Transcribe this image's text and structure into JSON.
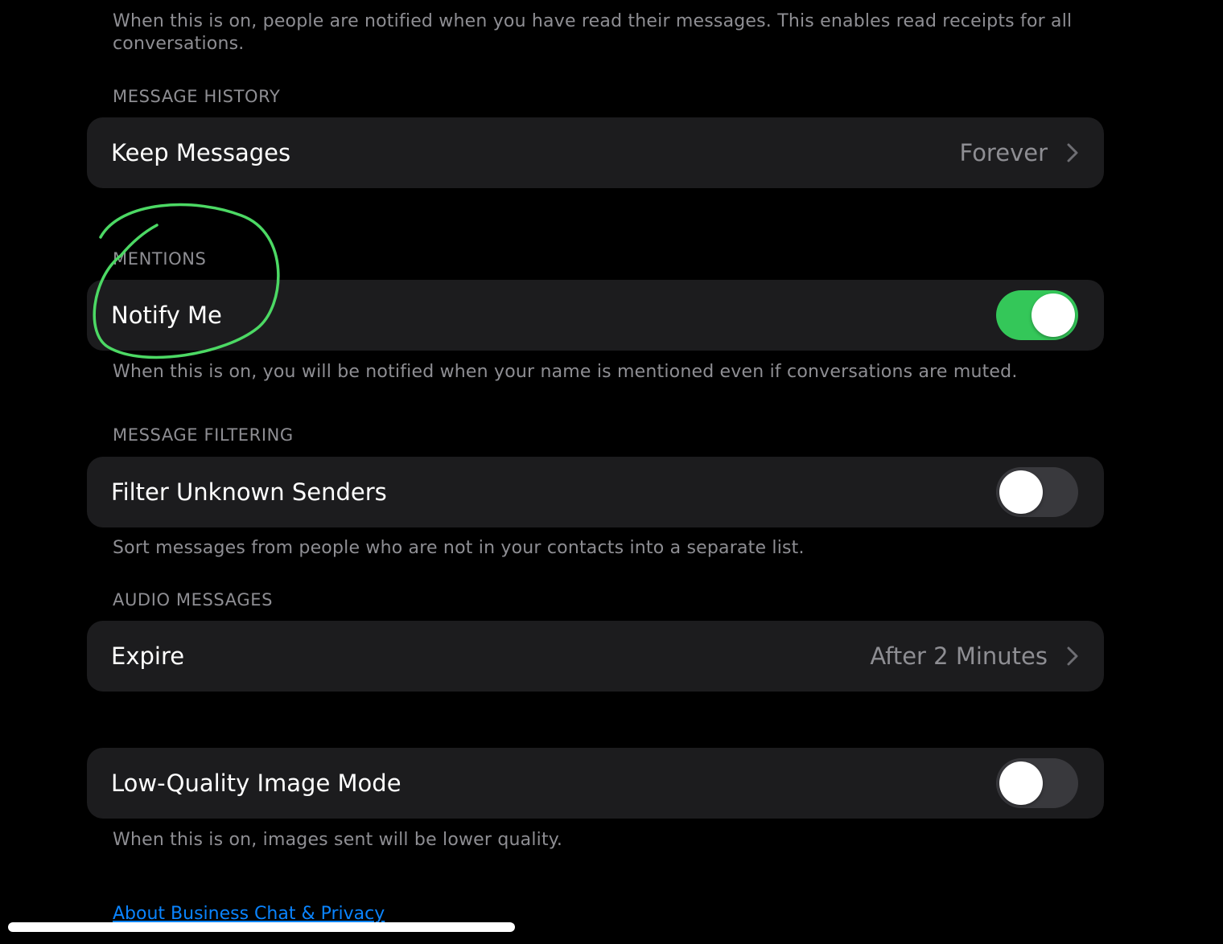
{
  "read_receipts": {
    "footer": "When this is on, people are notified when you have read their messages. This enables read receipts for all conversations."
  },
  "message_history": {
    "header": "MESSAGE HISTORY",
    "keep_messages_label": "Keep Messages",
    "keep_messages_value": "Forever"
  },
  "mentions": {
    "header": "MENTIONS",
    "notify_me_label": "Notify Me",
    "notify_me_on": true,
    "footer": "When this is on, you will be notified when your name is mentioned even if conversations are muted."
  },
  "message_filtering": {
    "header": "MESSAGE FILTERING",
    "filter_unknown_label": "Filter Unknown Senders",
    "filter_unknown_on": false,
    "footer": "Sort messages from people who are not in your contacts into a separate list."
  },
  "audio_messages": {
    "header": "AUDIO MESSAGES",
    "expire_label": "Expire",
    "expire_value": "After 2 Minutes"
  },
  "low_quality": {
    "label": "Low-Quality Image Mode",
    "on": false,
    "footer": "When this is on, images sent will be lower quality."
  },
  "link": {
    "text": "About Business Chat & Privacy"
  },
  "colors": {
    "background": "#000000",
    "card": "#1c1c1e",
    "secondary_text": "#8e8e93",
    "toggle_on": "#34c759",
    "toggle_off": "#39393d",
    "link": "#0a84ff",
    "annotation": "#4cd964"
  }
}
